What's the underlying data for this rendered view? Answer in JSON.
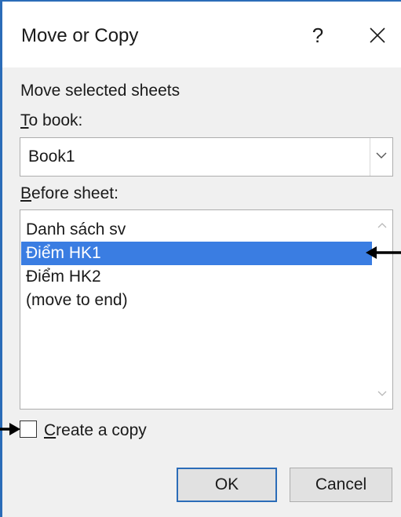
{
  "dialog": {
    "title": "Move or Copy",
    "help_label": "?",
    "close_icon": "close-icon"
  },
  "section_label": "Move selected sheets",
  "to_book": {
    "label_access_key": "T",
    "label_rest": "o book:",
    "selected_value": "Book1",
    "dropdown_icon": "chevron-down-icon"
  },
  "before_sheet": {
    "label_access_key": "B",
    "label_rest": "efore sheet:",
    "items": [
      {
        "label": "Danh sách sv",
        "selected": false
      },
      {
        "label": "Điểm HK1",
        "selected": true
      },
      {
        "label": "Điểm HK2",
        "selected": false
      },
      {
        "label": "(move to end)",
        "selected": false
      }
    ]
  },
  "create_copy": {
    "label_access_key": "C",
    "label_rest": "reate a copy",
    "checked": false
  },
  "buttons": {
    "ok": "OK",
    "cancel": "Cancel"
  },
  "colors": {
    "selection": "#3a7de2",
    "window_border": "#2b6cb8",
    "annotation_arrow": "#000000"
  }
}
